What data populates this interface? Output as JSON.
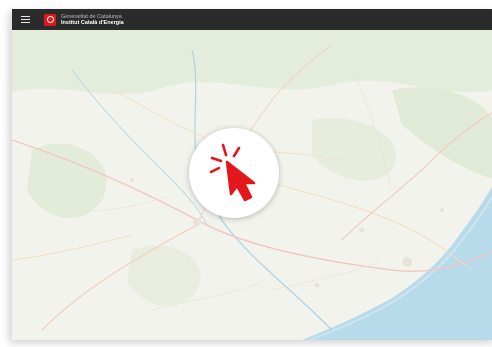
{
  "header": {
    "org_line1": "Generalitat de Catalunya",
    "org_line2": "Institut Català d'Energia",
    "menu_icon": "hamburger-menu-icon",
    "logo_icon": "generalitat-logo-icon"
  },
  "map": {
    "type": "street-map",
    "icon": "map-tiles"
  },
  "overlay": {
    "icon": "click-pointer-icon",
    "accent_color": "#e3171b"
  },
  "colors": {
    "topbar": "#2b2b2b",
    "land": "#e9eee4",
    "sea": "#a9d3e8",
    "brand_red": "#e3171b"
  }
}
